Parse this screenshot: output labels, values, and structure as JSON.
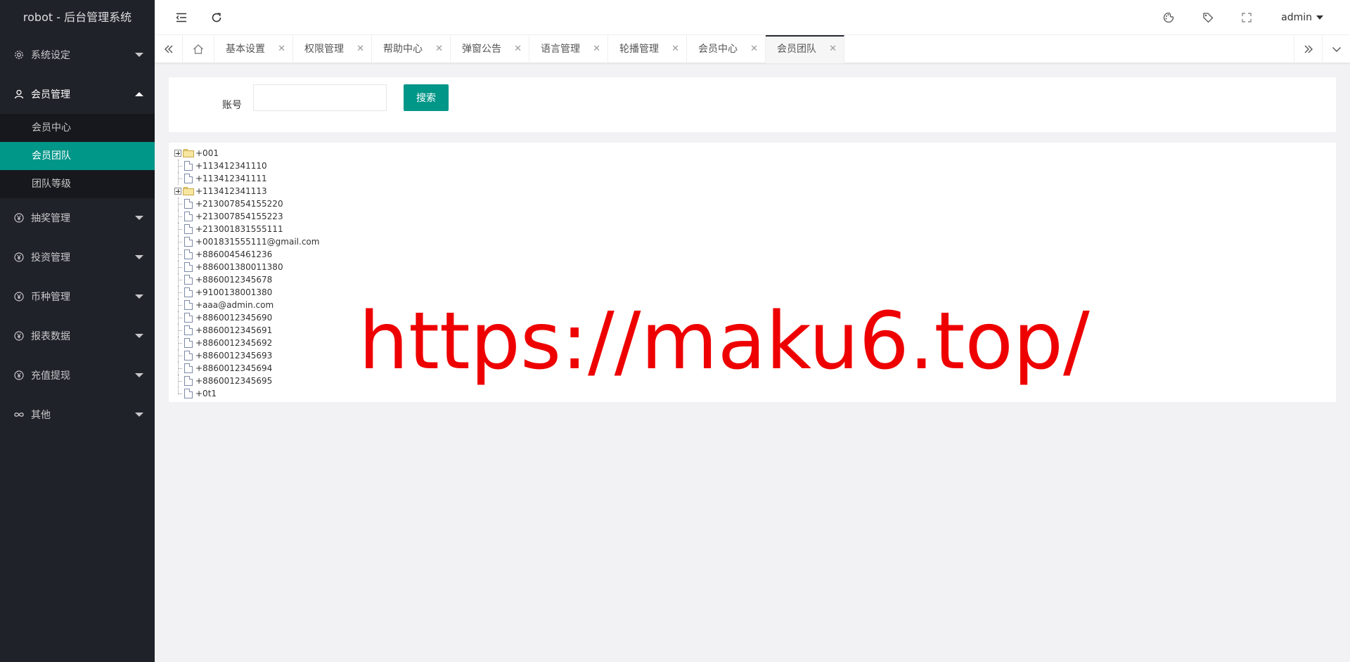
{
  "app": {
    "title": "robot - 后台管理系统"
  },
  "sidebar": {
    "groups": [
      {
        "label": "系统设定",
        "icon": "gear-icon",
        "open": false
      },
      {
        "label": "会员管理",
        "icon": "user-icon",
        "open": true,
        "items": [
          {
            "label": "会员中心",
            "active": false
          },
          {
            "label": "会员团队",
            "active": true
          },
          {
            "label": "团队等级",
            "active": false
          }
        ]
      },
      {
        "label": "抽奖管理",
        "icon": "yen-icon",
        "open": false
      },
      {
        "label": "投资管理",
        "icon": "yen-icon",
        "open": false
      },
      {
        "label": "币种管理",
        "icon": "yen-icon",
        "open": false
      },
      {
        "label": "报表数据",
        "icon": "yen-icon",
        "open": false
      },
      {
        "label": "充值提现",
        "icon": "yen-icon",
        "open": false
      },
      {
        "label": "其他",
        "icon": "infinity-icon",
        "open": false
      }
    ]
  },
  "header": {
    "user": "admin",
    "icons": [
      "menu-fold-icon",
      "refresh-icon",
      "theme-icon",
      "tag-icon",
      "fullscreen-icon"
    ]
  },
  "tabs": [
    {
      "label": "基本设置",
      "active": false
    },
    {
      "label": "权限管理",
      "active": false
    },
    {
      "label": "帮助中心",
      "active": false
    },
    {
      "label": "弹窗公告",
      "active": false
    },
    {
      "label": "语言管理",
      "active": false
    },
    {
      "label": "轮播管理",
      "active": false
    },
    {
      "label": "会员中心",
      "active": false
    },
    {
      "label": "会员团队",
      "active": true
    }
  ],
  "search": {
    "label": "账号",
    "value": "",
    "placeholder": "",
    "button": "搜索"
  },
  "tree": [
    {
      "label": "+001",
      "type": "folder"
    },
    {
      "label": "+113412341110",
      "type": "file"
    },
    {
      "label": "+113412341111",
      "type": "file"
    },
    {
      "label": "+113412341113",
      "type": "folder"
    },
    {
      "label": "+213007854155220",
      "type": "file"
    },
    {
      "label": "+213007854155223",
      "type": "file"
    },
    {
      "label": "+213001831555111",
      "type": "file"
    },
    {
      "label": "+001831555111@gmail.com",
      "type": "file"
    },
    {
      "label": "+8860045461236",
      "type": "file"
    },
    {
      "label": "+886001380011380",
      "type": "file"
    },
    {
      "label": "+8860012345678",
      "type": "file"
    },
    {
      "label": "+9100138001380",
      "type": "file"
    },
    {
      "label": "+aaa@admin.com",
      "type": "file"
    },
    {
      "label": "+8860012345690",
      "type": "file"
    },
    {
      "label": "+8860012345691",
      "type": "file"
    },
    {
      "label": "+8860012345692",
      "type": "file"
    },
    {
      "label": "+8860012345693",
      "type": "file"
    },
    {
      "label": "+8860012345694",
      "type": "file"
    },
    {
      "label": "+8860012345695",
      "type": "file"
    },
    {
      "label": "+0t1",
      "type": "file"
    }
  ],
  "watermark": "https://maku6.top/",
  "colors": {
    "sidebar": "#20222a",
    "accent": "#009688",
    "watermark": "#ee0000"
  }
}
